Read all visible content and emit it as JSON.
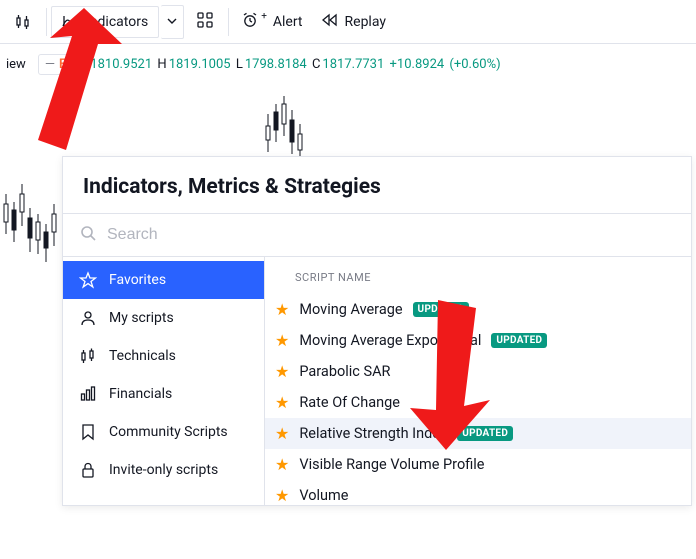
{
  "toolbar": {
    "indicators_label": "Indicators",
    "alert_label": "Alert",
    "replay_label": "Replay"
  },
  "ohlc": {
    "view_label": "iew",
    "symbol_hint": "E",
    "open_prefix": "O",
    "open": "1810.9521",
    "high_prefix": "H",
    "high": "1819.1005",
    "low_prefix": "L",
    "low": "1798.8184",
    "close_prefix": "C",
    "close": "1817.7731",
    "change": "+10.8924",
    "change_pct": "(+0.60%)"
  },
  "dialog": {
    "title": "Indicators, Metrics & Strategies",
    "search_placeholder": "Search",
    "sidebar": [
      {
        "id": "favorites",
        "label": "Favorites",
        "icon": "star-outline-icon",
        "active": true
      },
      {
        "id": "my-scripts",
        "label": "My scripts",
        "icon": "person-icon",
        "active": false
      },
      {
        "id": "technicals",
        "label": "Technicals",
        "icon": "candles-icon",
        "active": false
      },
      {
        "id": "financials",
        "label": "Financials",
        "icon": "bars-icon",
        "active": false
      },
      {
        "id": "community",
        "label": "Community Scripts",
        "icon": "bookmark-icon",
        "active": false
      },
      {
        "id": "invite-only",
        "label": "Invite-only scripts",
        "icon": "lock-icon",
        "active": false
      }
    ],
    "list_header": "SCRIPT NAME",
    "scripts": [
      {
        "label": "Moving Average",
        "updated": true,
        "selected": false
      },
      {
        "label": "Moving Average Exponential",
        "updated": true,
        "selected": false
      },
      {
        "label": "Parabolic SAR",
        "updated": false,
        "selected": false
      },
      {
        "label": "Rate Of Change",
        "updated": false,
        "selected": false
      },
      {
        "label": "Relative Strength Index",
        "updated": true,
        "selected": true
      },
      {
        "label": "Visible Range Volume Profile",
        "updated": false,
        "selected": false
      },
      {
        "label": "Volume",
        "updated": false,
        "selected": false
      }
    ],
    "updated_badge": "UPDATED"
  },
  "colors": {
    "accent": "#2962ff",
    "badge": "#089981",
    "star": "#ff9800",
    "arrow": "#ef1a1a"
  }
}
